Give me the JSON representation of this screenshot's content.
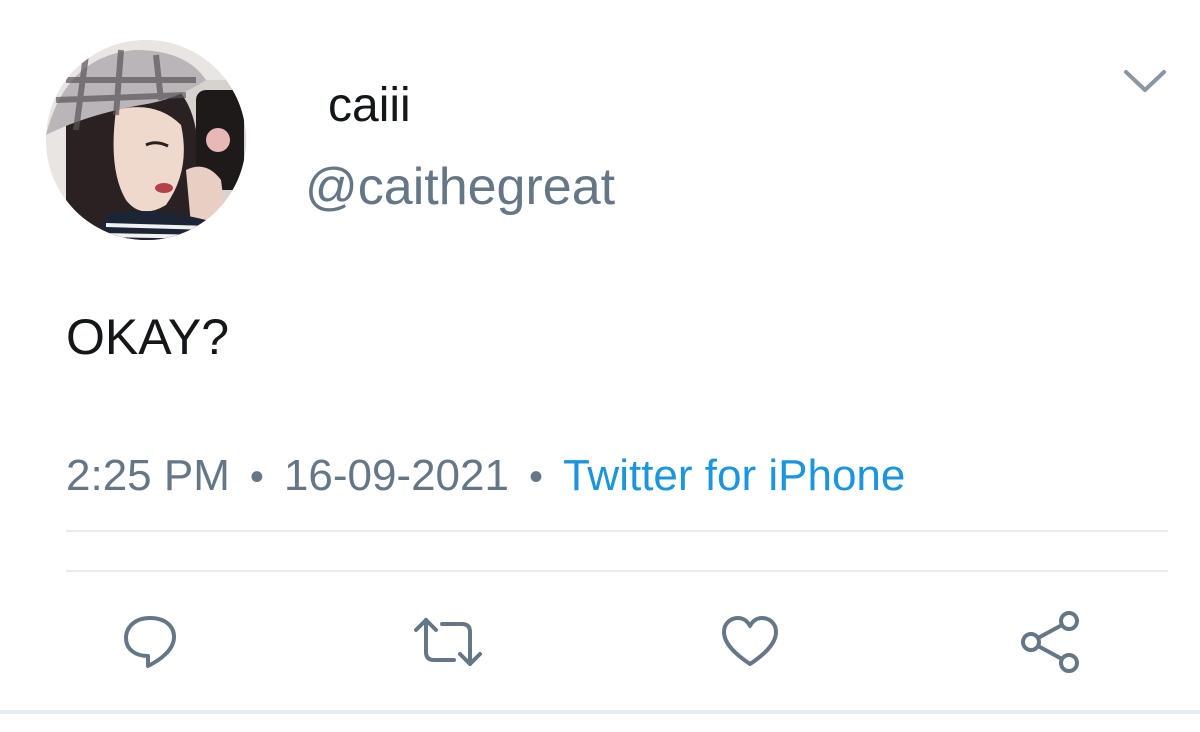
{
  "user": {
    "display_name": "caiii",
    "handle": "@caithegreat",
    "avatar": "profile-photo"
  },
  "tweet": {
    "text": "OKAY?"
  },
  "meta": {
    "time": "2:25 PM",
    "separator": "•",
    "date": "16-09-2021",
    "source": "Twitter for iPhone"
  },
  "actions": {
    "reply": "reply-icon",
    "retweet": "retweet-icon",
    "like": "heart-icon",
    "share": "share-icon"
  },
  "menu": {
    "icon": "chevron-down-icon"
  },
  "colors": {
    "text_primary": "#14171a",
    "text_secondary": "#657786",
    "link": "#1b95e0",
    "divider": "#e6ecf0",
    "icon": "#657786"
  }
}
